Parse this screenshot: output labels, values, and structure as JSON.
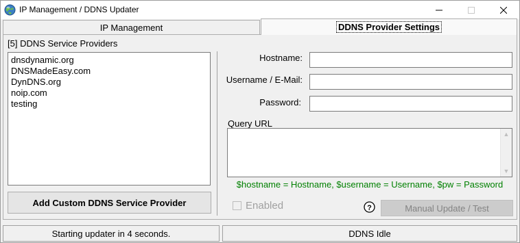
{
  "window": {
    "title": "IP Management / DDNS Updater",
    "controls": {
      "minimize": "minimize-icon",
      "maximize": "maximize-icon",
      "close": "close-icon"
    }
  },
  "tabs": [
    {
      "label": "IP Management",
      "active": false
    },
    {
      "label": "DDNS Provider Settings",
      "active": true
    }
  ],
  "providers": {
    "label": "[5] DDNS Service Providers",
    "items": [
      "dnsdynamic.org",
      "DNSMadeEasy.com",
      "DynDNS.org",
      "noip.com",
      "testing"
    ],
    "add_button_label": "Add Custom DDNS Service Provider"
  },
  "form": {
    "hostname_label": "Hostname:",
    "hostname_value": "",
    "username_label": "Username / E-Mail:",
    "username_value": "",
    "password_label": "Password:",
    "password_value": "",
    "query_url_label": "Query URL",
    "query_url_value": "",
    "hint": "$hostname = Hostname, $username = Username, $pw = Password",
    "enabled_label": "Enabled",
    "enabled_checked": false,
    "help_icon": "question-icon",
    "manual_button_label": "Manual Update / Test"
  },
  "status": {
    "left": "Starting updater in 4 seconds.",
    "right": "DDNS Idle"
  },
  "colors": {
    "hint_text": "#008000",
    "disabled_text": "#838383"
  }
}
